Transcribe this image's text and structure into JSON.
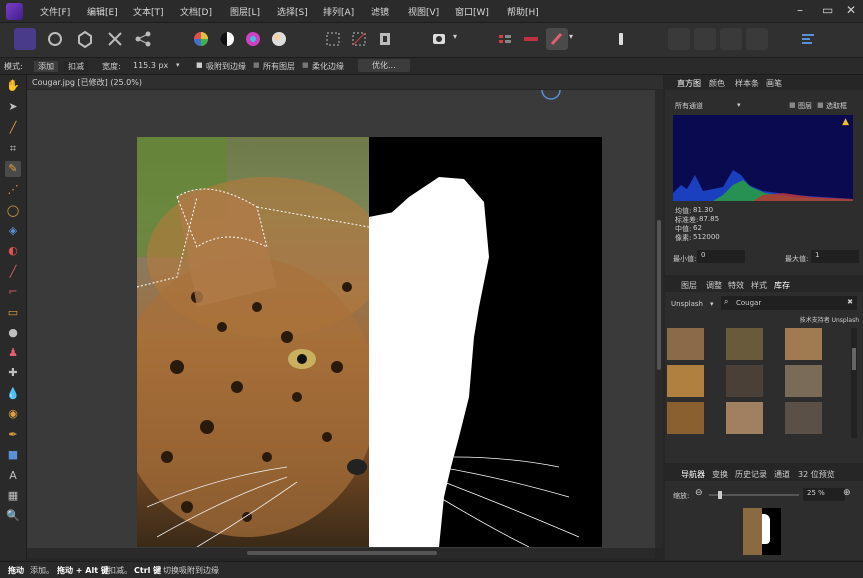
{
  "menubar": {
    "items": [
      "文件[F]",
      "编辑[E]",
      "文本[T]",
      "文档[D]",
      "图层[L]",
      "选择[S]",
      "排列[A]",
      "滤镜",
      "视图[V]",
      "窗口[W]",
      "帮助[H]"
    ]
  },
  "context_toolbar": {
    "mode_label": "模式:",
    "mode_add": "添加",
    "mode_subtract": "扣减",
    "width_label": "宽度:",
    "width_value": "115.3 px",
    "snap_edges_label": "吸附到边缘",
    "all_layers_label": "所有图层",
    "soften_edges_label": "柔化边缘",
    "refine_button": "优化..."
  },
  "document": {
    "title": "Cougar.jpg [已修改] (25.0%)"
  },
  "histogram_panel": {
    "tabs": [
      "直方图",
      "颜色",
      "样本条",
      "画笔"
    ],
    "channel": "所有通道",
    "layer_label": "图层",
    "selection_label": "选取框",
    "stats": [
      {
        "label": "均值:",
        "value": "81.30"
      },
      {
        "label": "标准差:",
        "value": "87.85"
      },
      {
        "label": "中值:",
        "value": "62"
      },
      {
        "label": "像素:",
        "value": "512000"
      }
    ],
    "min_label": "最小值:",
    "min_value": "0",
    "max_label": "最大值:",
    "max_value": "1",
    "warning_icon": "warning-icon"
  },
  "stock_panel": {
    "tabs": [
      "图层",
      "调整",
      "特效",
      "样式",
      "库存"
    ],
    "source": "Unsplash",
    "search_value": "Cougar",
    "credit": "技术支持者 Unsplash"
  },
  "navigator_panel": {
    "tabs": [
      "导航器",
      "变换",
      "历史记录",
      "通道",
      "32 位预览"
    ],
    "zoom_label": "缩放:",
    "zoom_value": "25 %",
    "zoom_level": 0.25
  },
  "statusbar": {
    "parts": [
      {
        "key": "拖动",
        "text": "添加。"
      },
      {
        "key": "拖动 + Alt 键",
        "text": "扣减。"
      },
      {
        "key": "Ctrl 键",
        "text": "切换吸附到边缘"
      }
    ]
  },
  "colors": {
    "accent": "#5b8fd6",
    "app_icon": "#6a35c0",
    "active_tool": "#4a4a4a"
  }
}
